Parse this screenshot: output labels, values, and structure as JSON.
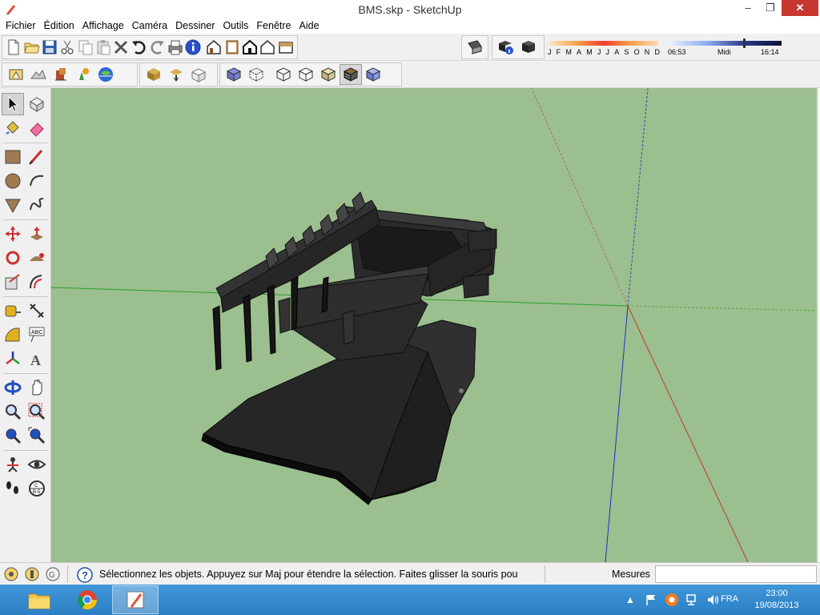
{
  "window": {
    "title": "BMS.skp - SketchUp",
    "minimize_glyph": "–",
    "maximize_glyph": "❐",
    "close_glyph": "✕"
  },
  "menu": [
    "Fichier",
    "Édition",
    "Affichage",
    "Caméra",
    "Dessiner",
    "Outils",
    "Fenêtre",
    "Aide"
  ],
  "shadow_settings": {
    "months": [
      "J",
      "F",
      "M",
      "A",
      "M",
      "J",
      "J",
      "A",
      "S",
      "O",
      "N",
      "D"
    ],
    "time_start": "06:53",
    "time_mid": "Midi",
    "time_end": "16:14"
  },
  "status": {
    "hint": "Sélectionnez les objets. Appuyez sur Maj pour étendre la sélection. Faites glisser la souris pou",
    "measure_label": "Mesures",
    "measure_value": ""
  },
  "taskbar": {
    "apps": [
      "file-explorer",
      "chrome",
      "sketchup"
    ],
    "active_app": "sketchup",
    "language": "FRA",
    "time": "23:00",
    "date": "19/08/2013"
  },
  "colors": {
    "viewport_bg": "#9cbf8f",
    "model_dark": "#232323",
    "axis_red": "#c0392b",
    "axis_green": "#27a12a",
    "axis_blue": "#2030c0",
    "taskbar": "#2d7fc4"
  }
}
